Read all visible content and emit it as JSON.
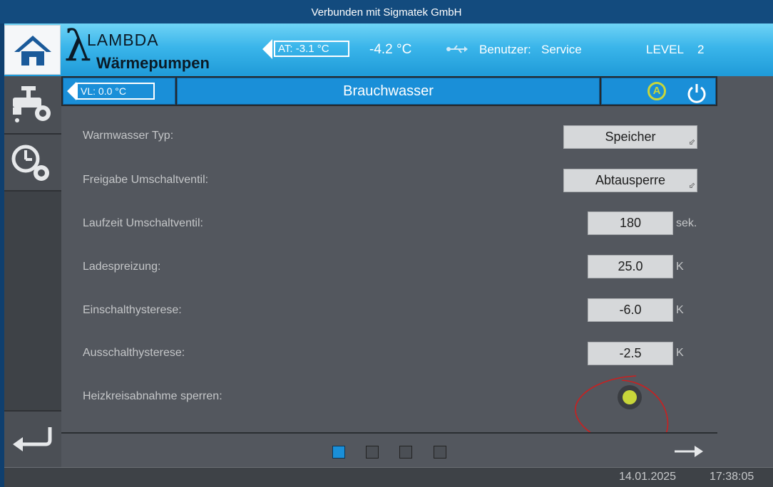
{
  "window": {
    "title": "Verbunden mit Sigmatek GmbH"
  },
  "header": {
    "logo_line1": "LAMBDA",
    "logo_line2": "Wärmepumpen",
    "at_value": "AT:  -3.1 °C",
    "temp": "-4.2 °C",
    "user_label": "Benutzer:",
    "user": "Service",
    "level_label": "LEVEL",
    "level": "2"
  },
  "subheader": {
    "vl_value": "VL:   0.0 °C",
    "title": "Brauchwasser",
    "auto_label": "A"
  },
  "settings": {
    "warmwasser_typ": {
      "label": "Warmwasser Typ:",
      "value": "Speicher"
    },
    "freigabe": {
      "label": "Freigabe Umschaltventil:",
      "value": "Abtausperre"
    },
    "laufzeit": {
      "label": "Laufzeit Umschaltventil:",
      "value": "180",
      "unit": "sek."
    },
    "ladespreizung": {
      "label": "Ladespreizung:",
      "value": "25.0",
      "unit": "K"
    },
    "einschalt": {
      "label": "Einschalthysterese:",
      "value": "-6.0",
      "unit": "K"
    },
    "ausschalt": {
      "label": "Ausschalthysterese:",
      "value": "-2.5",
      "unit": "K"
    },
    "heizkreis": {
      "label": "Heizkreisabnahme sperren:",
      "state": "on"
    }
  },
  "pagination": {
    "total": 4,
    "active": 1
  },
  "status": {
    "date": "14.01.2025",
    "time": "17:38:05"
  },
  "colors": {
    "accent": "#1a8fd8",
    "indicator": "#c8d63a",
    "annotation": "#cc1f1f"
  }
}
